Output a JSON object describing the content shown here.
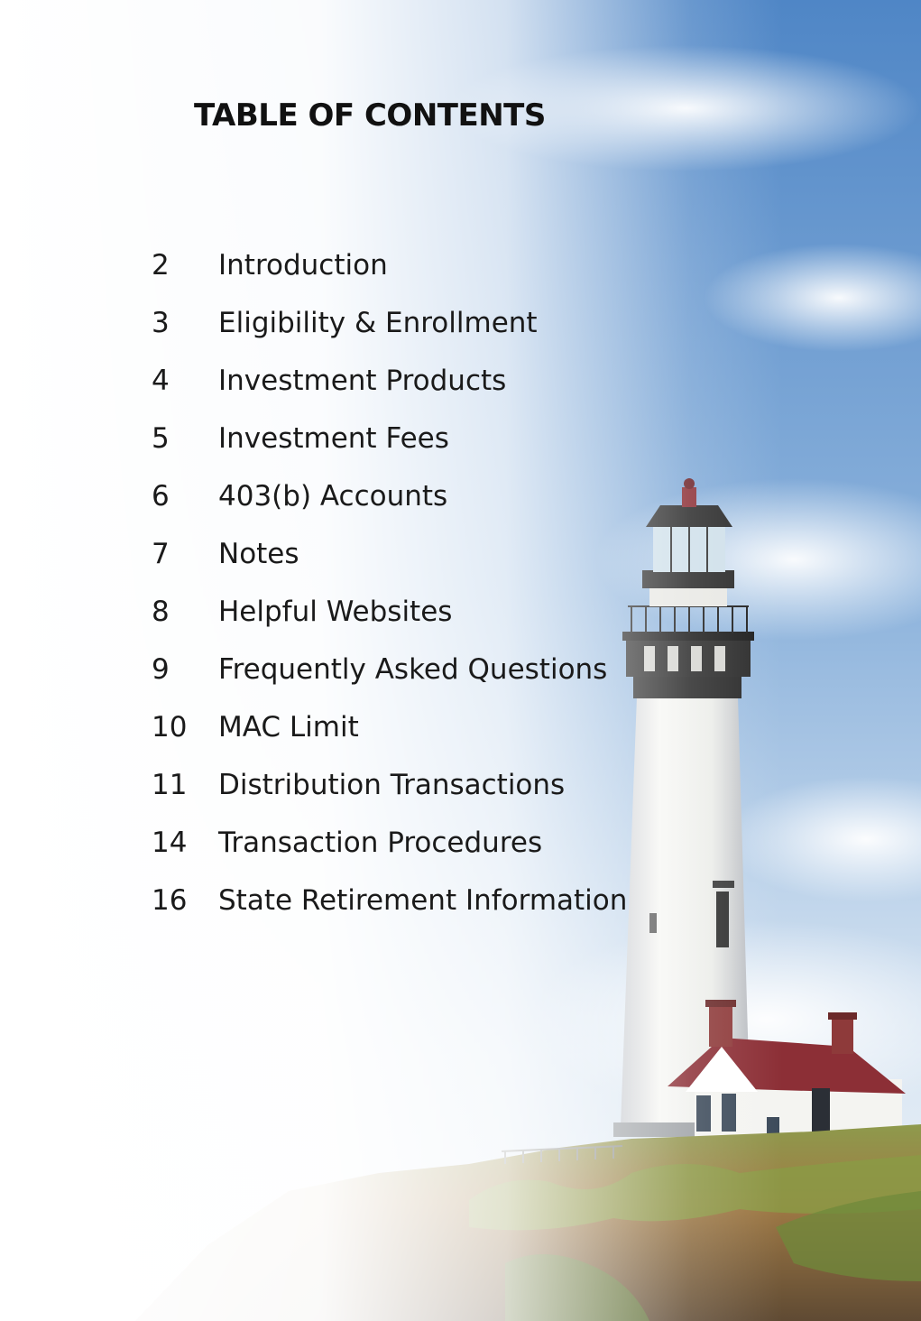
{
  "document": {
    "title": "TABLE OF CONTENTS"
  },
  "toc": [
    {
      "page": "2",
      "label": "Introduction"
    },
    {
      "page": "3",
      "label": "Eligibility & Enrollment"
    },
    {
      "page": "4",
      "label": "Investment Products"
    },
    {
      "page": "5",
      "label": "Investment Fees"
    },
    {
      "page": "6",
      "label": "403(b) Accounts"
    },
    {
      "page": "7",
      "label": "Notes"
    },
    {
      "page": "8",
      "label": "Helpful Websites"
    },
    {
      "page": "9",
      "label": "Frequently Asked Questions"
    },
    {
      "page": "10",
      "label": "MAC Limit"
    },
    {
      "page": "11",
      "label": "Distribution Transactions"
    },
    {
      "page": "14",
      "label": "Transaction Procedures"
    },
    {
      "page": "16",
      "label": "State Retirement Information"
    }
  ],
  "colors": {
    "sky": "#5b8fc9",
    "lighthouse_white": "#f2f2ee",
    "lantern_black": "#222222",
    "roof_red": "#8c2f36",
    "cliff_green": "#7b8a45"
  }
}
